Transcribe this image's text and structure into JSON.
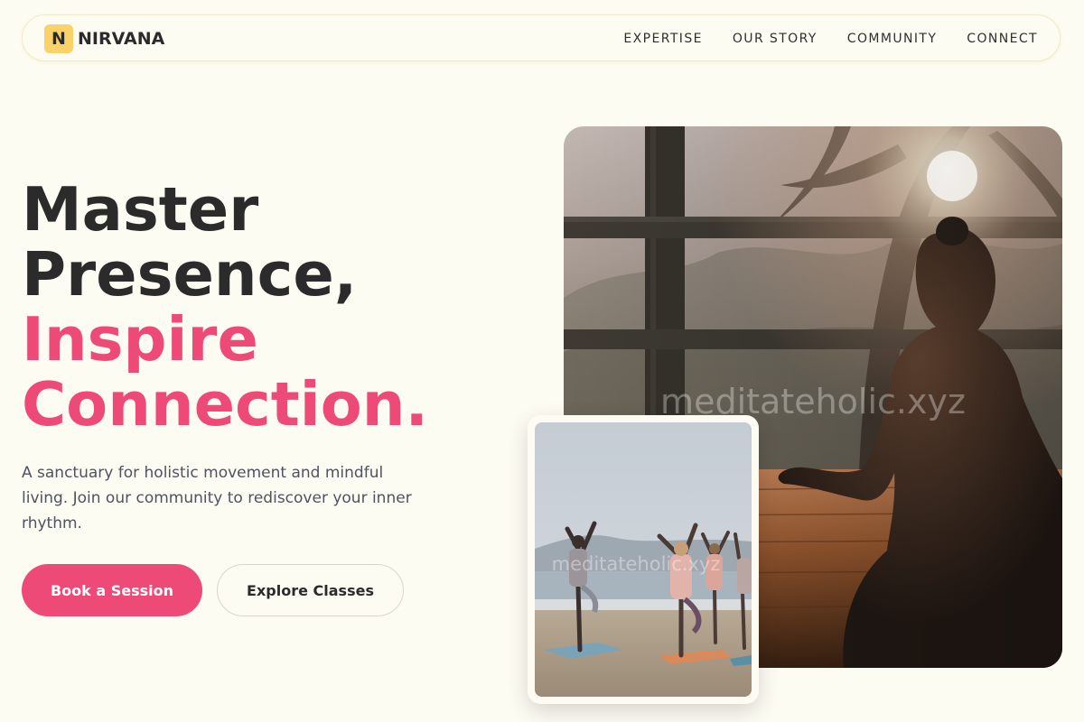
{
  "brand": {
    "logo_letter": "N",
    "name": "NIRVANA"
  },
  "nav": {
    "links": [
      {
        "label": "EXPERTISE"
      },
      {
        "label": "OUR STORY"
      },
      {
        "label": "COMMUNITY"
      },
      {
        "label": "CONNECT"
      }
    ]
  },
  "hero": {
    "headline_line1": "Master",
    "headline_line2": "Presence,",
    "headline_accent_line1": "Inspire",
    "headline_accent_line2": "Connection.",
    "subtext": "A sanctuary for holistic movement and mindful living. Join our community to rediscover your inner rhythm.",
    "primary_button": "Book a Session",
    "secondary_button": "Explore Classes"
  },
  "images": {
    "main_watermark": "meditateholic.xyz",
    "secondary_watermark": "meditateholic.xyz"
  },
  "colors": {
    "background": "#fdfcf3",
    "accent": "#ee4a78",
    "logo_badge": "#fbd26a",
    "text_dark": "#2b2b2b",
    "text_muted": "#4f5260"
  }
}
